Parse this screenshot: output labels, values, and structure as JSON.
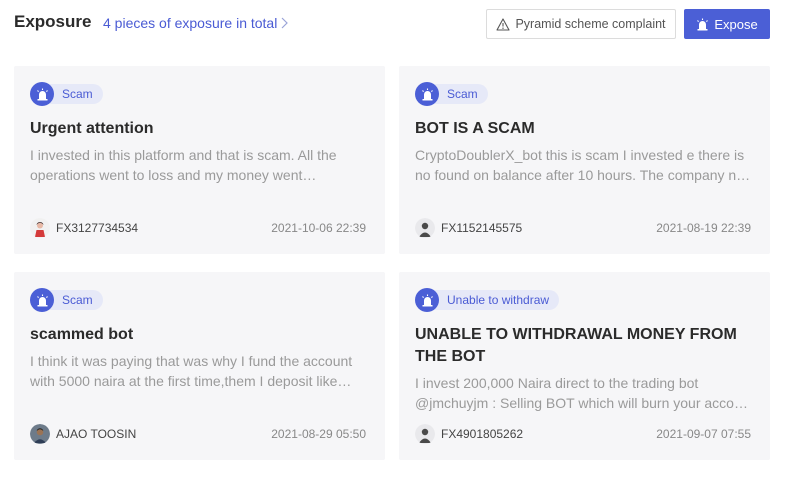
{
  "header": {
    "title": "Exposure",
    "total_link": "4 pieces of exposure in total",
    "complaint_button": "Pyramid scheme complaint",
    "expose_button": "Expose"
  },
  "colors": {
    "accent": "#4b5fd6",
    "tag_bg": "#e6e9f8",
    "card_bg": "#f6f6f8"
  },
  "cards": [
    {
      "tag": "Scam",
      "title": "Urgent attention",
      "body": "I invested in this platform and that is scam. All the operations went to loss and my money went…",
      "user": "FX3127734534",
      "avatar": "red-figure-avatar",
      "date": "2021-10-06 22:39"
    },
    {
      "tag": "Scam",
      "title": "BOT IS A SCAM",
      "body": "CryptoDoublerX_bot this is scam I invested e there is no found on balance after 10 hours. The company n…",
      "user": "FX1152145575",
      "avatar": "default-person-avatar",
      "date": "2021-08-19 22:39"
    },
    {
      "tag": "Scam",
      "title": "scammed bot",
      "body": "I think it was paying that was why I fund the account with 5000 naira at the first time,them I deposit like…",
      "user": "AJAO TOOSIN",
      "avatar": "photo-avatar",
      "date": "2021-08-29 05:50"
    },
    {
      "tag": "Unable to withdraw",
      "title": "UNABLE TO WITHDRAWAL MONEY FROM THE BOT",
      "body": "I invest 200,000 Naira direct to the trading bot @jmchuyjm : Selling BOT which will burn your acco…",
      "user": "FX4901805262",
      "avatar": "default-person-avatar",
      "date": "2021-09-07 07:55"
    }
  ]
}
